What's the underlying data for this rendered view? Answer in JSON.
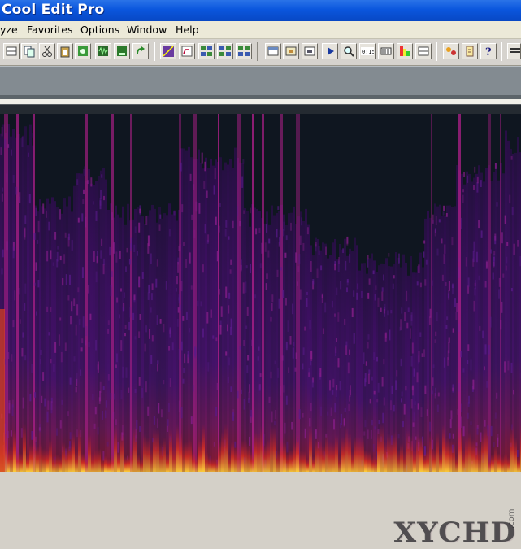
{
  "window": {
    "title": "Cool Edit Pro"
  },
  "menu": [
    {
      "label": "yze"
    },
    {
      "label": "Favorites"
    },
    {
      "label": "Options"
    },
    {
      "label": "Window"
    },
    {
      "label": "Help"
    }
  ],
  "toolbar": {
    "time_button_label": "0:15"
  },
  "watermark": {
    "text": "XYCHD",
    "domain": ".com"
  },
  "colors": {
    "titlebar": "#0a56dd",
    "spectrogram_low": "#3a0d5e",
    "spectrogram_high": "#ffd23a"
  }
}
